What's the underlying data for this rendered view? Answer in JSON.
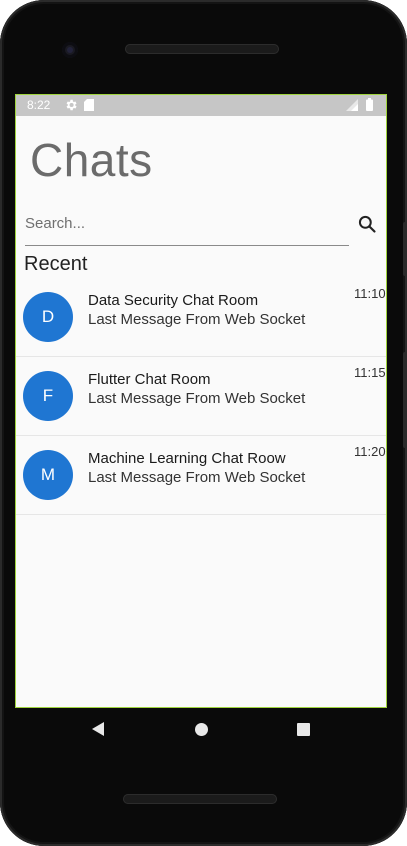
{
  "status_bar": {
    "time": "8:22",
    "icons": [
      "gear-icon",
      "sd-card-icon",
      "signal-icon",
      "battery-icon"
    ]
  },
  "header": {
    "title": "Chats"
  },
  "search": {
    "placeholder": "Search...",
    "value": "",
    "icon": "search-icon"
  },
  "section": {
    "recent_label": "Recent"
  },
  "chats": [
    {
      "initial": "D",
      "title": "Data Security Chat Room",
      "last_message": "Last Message From Web Socket",
      "time": "11:10"
    },
    {
      "initial": "F",
      "title": "Flutter Chat Room",
      "last_message": "Last Message From Web Socket",
      "time": "11:15"
    },
    {
      "initial": "M",
      "title": "Machine Learning Chat Roow",
      "last_message": "Last Message From Web Socket",
      "time": "11:20"
    }
  ],
  "nav_bar": {
    "buttons": [
      "back-icon",
      "home-icon",
      "recents-icon"
    ]
  },
  "colors": {
    "avatar": "#1f76d2",
    "status_bar": "#c6c6c6",
    "screen_background": "#fafafa",
    "title_text": "#6b6b6b"
  }
}
